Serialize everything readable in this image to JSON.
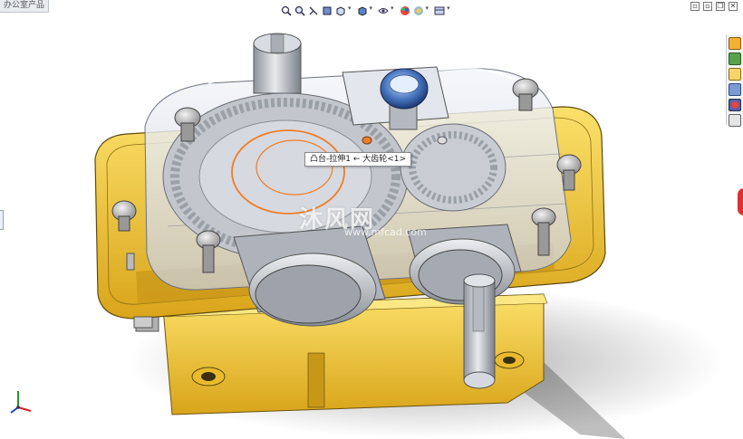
{
  "document_tab": {
    "label": "办公室产品"
  },
  "view_toolbar": {
    "items": [
      "zoom-to-fit-icon",
      "zoom-area-icon",
      "previous-view-icon",
      "section-view-icon",
      "view-orientation-icon",
      "display-style-icon",
      "hide-show-items-icon",
      "edit-appearance-icon",
      "apply-scene-icon",
      "view-settings-icon"
    ]
  },
  "window_controls": {
    "items": [
      "tile-icon",
      "tile-vertical-icon",
      "restore-icon",
      "close-icon"
    ]
  },
  "task_pane": {
    "items": [
      "home-icon",
      "design-library-icon",
      "file-explorer-icon",
      "view-palette-icon",
      "appearances-icon",
      "custom-properties-icon"
    ]
  },
  "model": {
    "name": "gearbox-reducer",
    "housing_color": "#f2c531",
    "cover_color": "#d9dde6",
    "gear_color": "#b9bcc4",
    "highlight_color": "#f07d28"
  },
  "tooltip": {
    "text": "凸台-拉伸1 ← 大齿轮<1>"
  },
  "watermark": {
    "text": "沐风网",
    "url": "www.mfcad.com"
  },
  "triad": {
    "x_color": "#d92020",
    "y_color": "#1f9a1f",
    "z_color": "#2040d0"
  }
}
